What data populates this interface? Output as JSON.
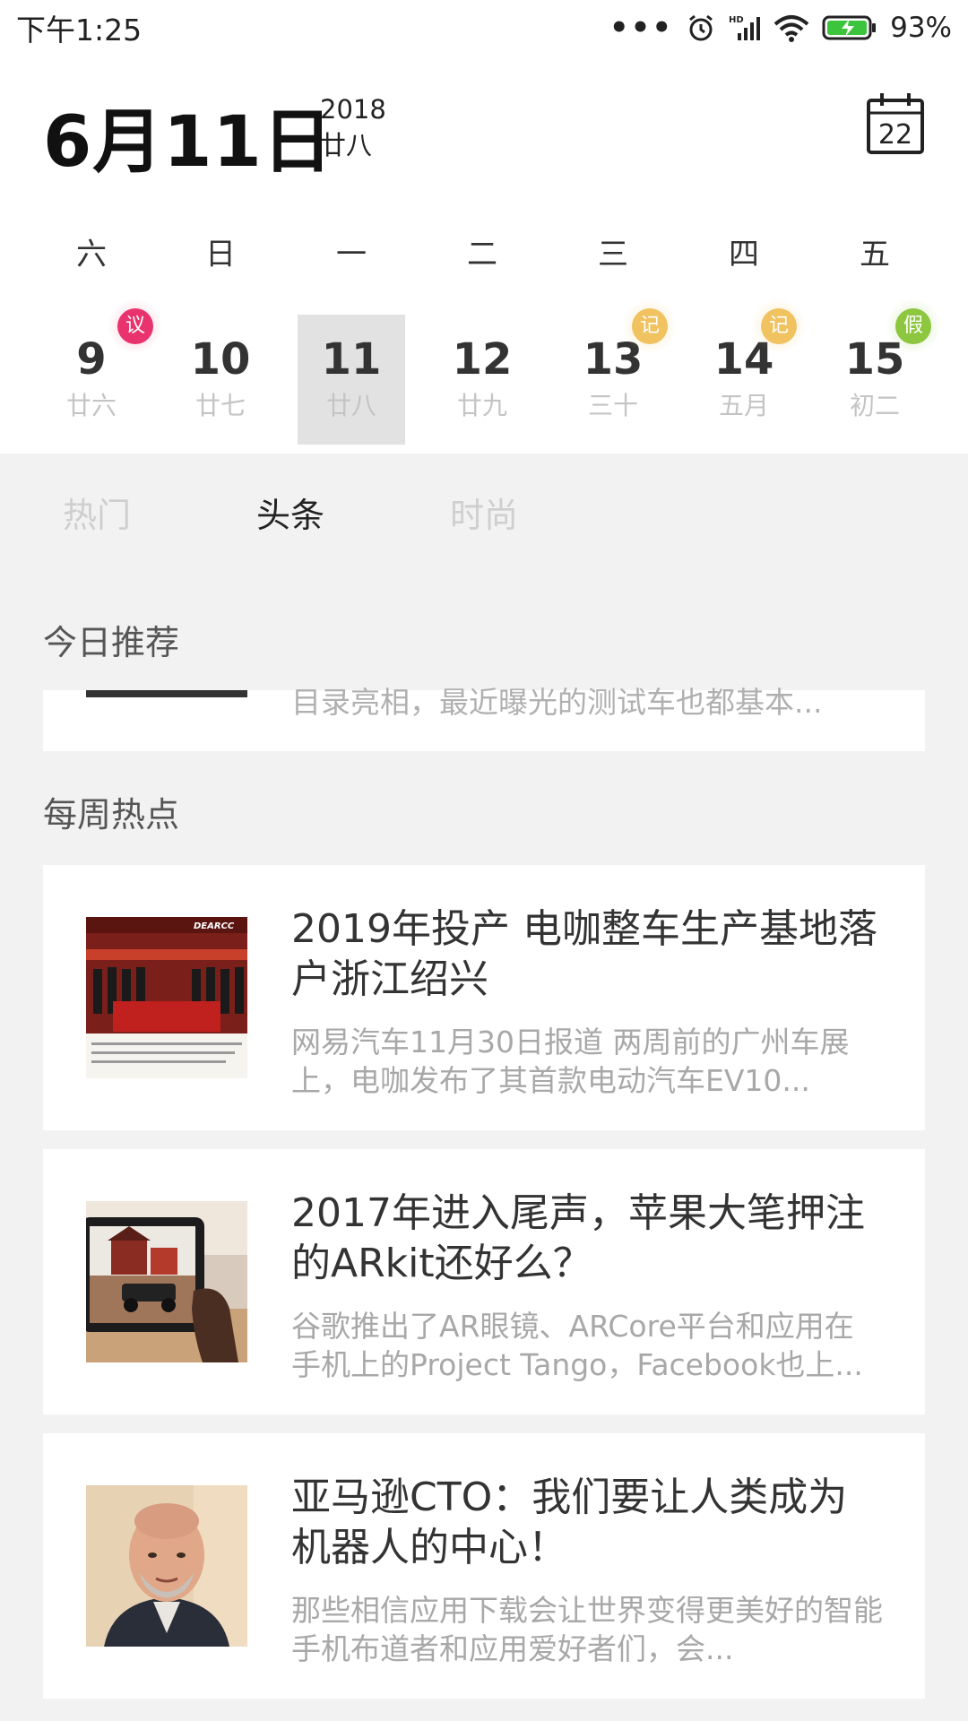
{
  "status_bar": {
    "time": "下午1:25",
    "battery_percent": "93%",
    "icons": [
      "more-dots-icon",
      "alarm-icon",
      "hd-signal-icon",
      "wifi-icon",
      "battery-charging-icon"
    ]
  },
  "header": {
    "date": "6月11日",
    "year": "2018",
    "lunar": "廿八",
    "calendar_button_day": "22"
  },
  "week": {
    "weekdays": [
      "六",
      "日",
      "一",
      "二",
      "三",
      "四",
      "五"
    ],
    "days": [
      {
        "num": "9",
        "lunar": "廿六",
        "badge": "议"
      },
      {
        "num": "10",
        "lunar": "廿七",
        "badge": ""
      },
      {
        "num": "11",
        "lunar": "廿八",
        "badge": "",
        "selected": true
      },
      {
        "num": "12",
        "lunar": "廿九",
        "badge": ""
      },
      {
        "num": "13",
        "lunar": "三十",
        "badge": "记"
      },
      {
        "num": "14",
        "lunar": "五月",
        "badge": "记"
      },
      {
        "num": "15",
        "lunar": "初二",
        "badge": "假"
      }
    ],
    "badge_colors": {
      "议": "#e8336e",
      "记": "#f0c260",
      "假": "#8dc63f"
    }
  },
  "tabs": [
    {
      "label": "热门",
      "active": false
    },
    {
      "label": "头条",
      "active": true
    },
    {
      "label": "时尚",
      "active": false
    }
  ],
  "sections": {
    "today": {
      "title": "今日推荐",
      "partial_desc": "目录亮相，最近曝光的测试车也都基本..."
    },
    "weekly": {
      "title": "每周热点",
      "articles": [
        {
          "title": "2019年投产 电咖整车生产基地落户浙江绍兴",
          "desc": "网易汽车11月30日报道 两周前的广州车展上，电咖发布了其首款电动汽车EV10...",
          "thumb_text": "DEARCC"
        },
        {
          "title": "2017年进入尾声，苹果大笔押注的ARkit还好么？",
          "desc": "谷歌推出了AR眼镜、ARCore平台和应用在手机上的Project Tango，Facebook也上..."
        },
        {
          "title": "亚马逊CTO：我们要让人类成为机器人的中心！",
          "desc": "那些相信应用下载会让世界变得更美好的智能手机布道者和应用爱好者们，会..."
        }
      ]
    }
  }
}
